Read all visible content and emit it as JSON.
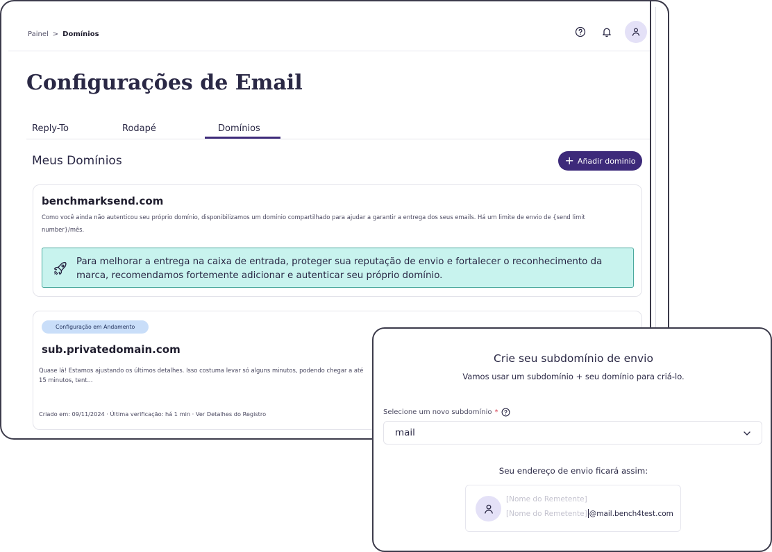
{
  "breadcrumb": {
    "parent": "Painel",
    "separator": ">",
    "current": "Domínios"
  },
  "page": {
    "title": "Configurações de Email"
  },
  "tabs": [
    {
      "label": "Reply-To"
    },
    {
      "label": "Rodapé"
    },
    {
      "label": "Domínios",
      "active": true
    }
  ],
  "section": {
    "title": "Meus Domínios",
    "add_button": "Añadir dominio"
  },
  "cards": [
    {
      "domain": "benchmarksend.com",
      "description": "Como você ainda não autenticou seu próprio domínio, disponibilizamos um domínio compartilhado para ajudar a garantir a entrega dos seus emails. Há um limite de envio de {send limit number}/mês.",
      "info": "Para melhorar a entrega na caixa de entrada, proteger sua reputação de envio e fortalecer o reconhecimento da marca, recomendamos fortemente adicionar e autenticar seu próprio domínio."
    },
    {
      "badge": "Configuração em Andamento",
      "domain": "sub.privatedomain.com",
      "description": "Quase lá! Estamos ajustando os últimos detalhes. Isso costuma levar só alguns minutos, podendo chegar a até 15 minutos, tent...",
      "meta": "Criado em: 09/11/2024 · Última verificação: há 1 min · Ver Detalhes do Registro"
    }
  ],
  "modal": {
    "title": "Crie seu subdomínio de envio",
    "subtitle": "Vamos usar um subdomínio + seu domínio para criá-lo.",
    "field_label": "Selecione um novo subdomínio",
    "required_mark": "*",
    "selected_value": "mail",
    "preview_label": "Seu endereço de envio ficará assim:",
    "sender_name_placeholder": "[Nome do Remetente]",
    "sender_local_placeholder": "[Nome do Remetente]",
    "sender_domain": "@mail.bench4test.com"
  },
  "colors": {
    "primary": "#3d2a7a",
    "info_bg": "#c8f3ee",
    "info_border": "#4aa89d",
    "badge_bg": "#c9def9",
    "avatar_bg": "#e4e1f7"
  },
  "icons": [
    "help-circle-icon",
    "bell-icon",
    "user-icon",
    "plus-icon",
    "rocket-icon",
    "chevron-down-icon"
  ]
}
